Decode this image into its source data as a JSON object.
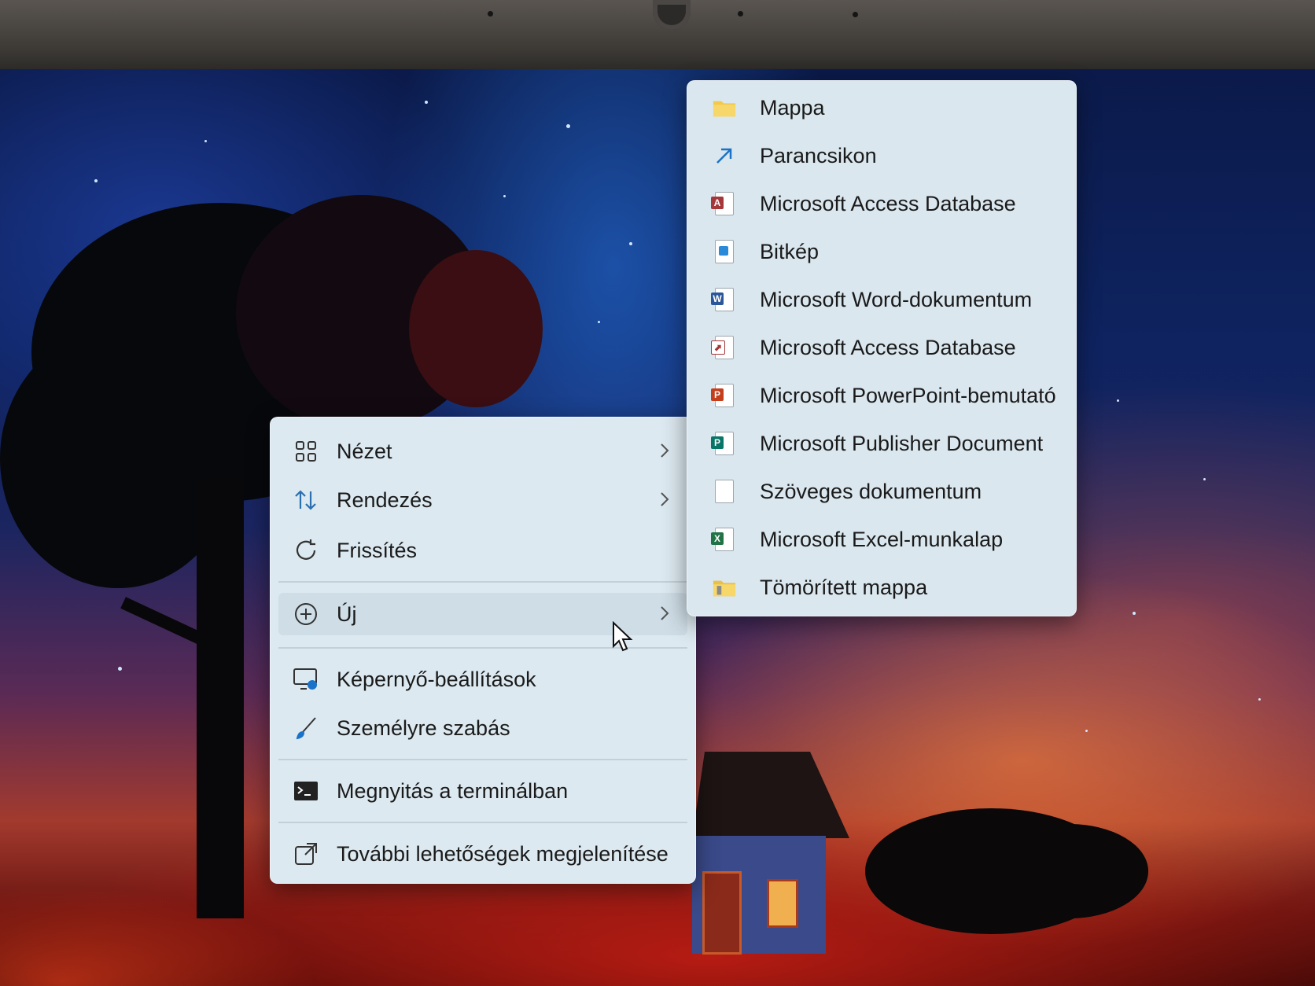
{
  "context_menu": {
    "items": [
      {
        "label": "Nézet",
        "icon": "grid-view-icon",
        "submenu": true
      },
      {
        "label": "Rendezés",
        "icon": "sort-arrows-icon",
        "submenu": true
      },
      {
        "label": "Frissítés",
        "icon": "refresh-icon",
        "submenu": false
      },
      {
        "label": "Új",
        "icon": "add-circle-icon",
        "submenu": true
      },
      {
        "label": "Képernyő-beállítások",
        "icon": "display-settings-icon",
        "submenu": false
      },
      {
        "label": "Személyre szabás",
        "icon": "brush-icon",
        "submenu": false
      },
      {
        "label": "Megnyitás a terminálban",
        "icon": "terminal-icon",
        "submenu": false
      },
      {
        "label": "További lehetőségek megjelenítése",
        "icon": "share-external-icon",
        "submenu": false
      }
    ],
    "active_item": "Új"
  },
  "new_submenu": {
    "items": [
      {
        "label": "Mappa",
        "icon": "folder-icon"
      },
      {
        "label": "Parancsikon",
        "icon": "shortcut-arrow-icon"
      },
      {
        "label": "Microsoft Access Database",
        "icon": "access-file-icon"
      },
      {
        "label": "Bitkép",
        "icon": "bitmap-file-icon"
      },
      {
        "label": "Microsoft Word-dokumentum",
        "icon": "word-file-icon"
      },
      {
        "label": "Microsoft Access Database",
        "icon": "access-file-icon"
      },
      {
        "label": "Microsoft PowerPoint-bemutató",
        "icon": "powerpoint-file-icon"
      },
      {
        "label": "Microsoft Publisher Document",
        "icon": "publisher-file-icon"
      },
      {
        "label": "Szöveges dokumentum",
        "icon": "text-file-icon"
      },
      {
        "label": "Microsoft Excel-munkalap",
        "icon": "excel-file-icon"
      },
      {
        "label": "Tömörített mappa",
        "icon": "zip-folder-icon"
      }
    ]
  },
  "colors": {
    "menu_bg": "#dce9f0",
    "access": "#a4373a",
    "word": "#2b579a",
    "powerpoint": "#c43e1c",
    "publisher": "#077568",
    "excel": "#217346",
    "shortcut": "#1a73c8",
    "folder": "#f2c94c"
  }
}
